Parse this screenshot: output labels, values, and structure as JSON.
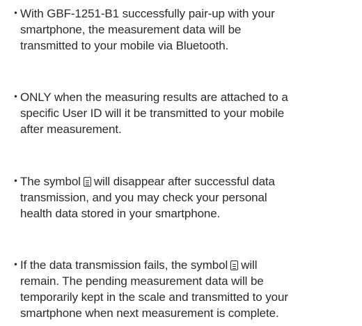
{
  "bullets": [
    {
      "marker": "・",
      "text": "With GBF-1251-B1 successfully pair-up with your\nsmartphone, the measurement data will be\ntransmitted to your mobile via Bluetooth."
    },
    {
      "marker": "・",
      "text": "ONLY when the measuring results are attached to a\nspecific User ID will it be transmitted to your mobile\nafter measurement."
    },
    {
      "marker": "・",
      "text_before": "The symbol",
      "text_after": "will disappear after successful data\ntransmission, and you may check your personal\nhealth data stored in your smartphone.",
      "icon": "data-pending-symbol-icon"
    },
    {
      "marker": "・",
      "text_before": "If the data transmission fails, the symbol",
      "text_after": "will\nremain. The pending measurement data will be\ntemporarily kept in the scale and transmitted to your\nsmartphone when next measurement is complete.",
      "icon": "data-pending-symbol-icon"
    }
  ]
}
